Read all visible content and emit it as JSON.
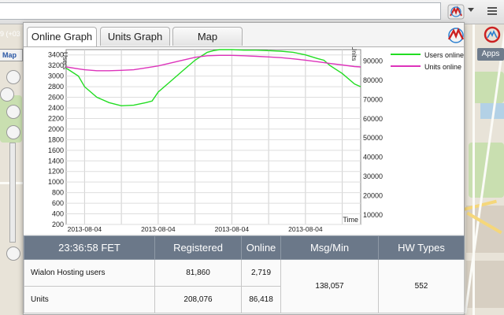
{
  "background_page": {
    "timezone_fragment": "9 (+03",
    "map_tab_label": "Map",
    "apps_label": "Apps"
  },
  "popup": {
    "tabs": [
      {
        "label": "Online Graph",
        "active": true
      },
      {
        "label": "Units Graph",
        "active": false
      },
      {
        "label": "Map",
        "active": false
      }
    ],
    "graph": {
      "legend": [
        {
          "name": "Users online",
          "color": "#22dd22"
        },
        {
          "name": "Units online",
          "color": "#dd33bb"
        }
      ]
    },
    "stats": {
      "columns": [
        "23:36:58 FET",
        "Registered",
        "Online",
        "Msg/Min",
        "HW Types"
      ],
      "rows": [
        {
          "label": "Wialon Hosting users",
          "registered": "81,860",
          "online": "2,719"
        },
        {
          "label": "Units",
          "registered": "208,076",
          "online": "86,418"
        }
      ],
      "msg_per_min": "138,057",
      "hw_types": "552"
    }
  },
  "chart_data": {
    "type": "line",
    "title": "",
    "xlabel": "Time",
    "ylabel_left": "Users",
    "ylabel_right": "Units",
    "x_ticks": [
      "2013-08-04 00:00:00",
      "2013-08-04 06:00:00",
      "2013-08-04 12:00:00",
      "2013-08-04 18:00:00"
    ],
    "x_range_hours": [
      -1.5,
      22.5
    ],
    "left_ylim": [
      200,
      3500
    ],
    "left_ticks": [
      200,
      400,
      600,
      800,
      1000,
      1200,
      1400,
      1600,
      1800,
      2000,
      2200,
      2400,
      2600,
      2800,
      3000,
      3200,
      3400
    ],
    "right_ylim": [
      5000,
      96000
    ],
    "right_ticks": [
      10000,
      20000,
      30000,
      40000,
      50000,
      60000,
      70000,
      80000,
      90000
    ],
    "grid": true,
    "legend_position": "right",
    "series": [
      {
        "name": "Users online",
        "axis": "left",
        "color": "#22dd22",
        "x": [
          -1.5,
          -0.5,
          0,
          1,
          2,
          3,
          4,
          5,
          5.5,
          6,
          7,
          8,
          9,
          10,
          10.5,
          11,
          12,
          13,
          14,
          15,
          16,
          17,
          18,
          19,
          19.5,
          20,
          21,
          22,
          22.5
        ],
        "y": [
          3150,
          3000,
          2800,
          2600,
          2500,
          2440,
          2450,
          2500,
          2530,
          2700,
          2900,
          3100,
          3300,
          3450,
          3480,
          3500,
          3500,
          3490,
          3490,
          3480,
          3470,
          3450,
          3400,
          3330,
          3300,
          3200,
          3050,
          2850,
          2800
        ]
      },
      {
        "name": "Units online",
        "axis": "right",
        "color": "#dd33bb",
        "x": [
          -1.5,
          -0.5,
          0,
          1,
          2,
          3,
          4,
          5,
          6,
          7,
          8,
          9,
          10,
          11,
          12,
          13,
          14,
          15,
          16,
          17,
          18,
          19,
          20,
          21,
          22,
          22.5
        ],
        "y": [
          87000,
          86000,
          85500,
          85000,
          85000,
          85200,
          85500,
          86500,
          87500,
          89000,
          90500,
          92000,
          92800,
          93000,
          93000,
          92800,
          92500,
          92200,
          91800,
          91200,
          90500,
          89700,
          88800,
          88000,
          87200,
          87000
        ]
      }
    ]
  }
}
